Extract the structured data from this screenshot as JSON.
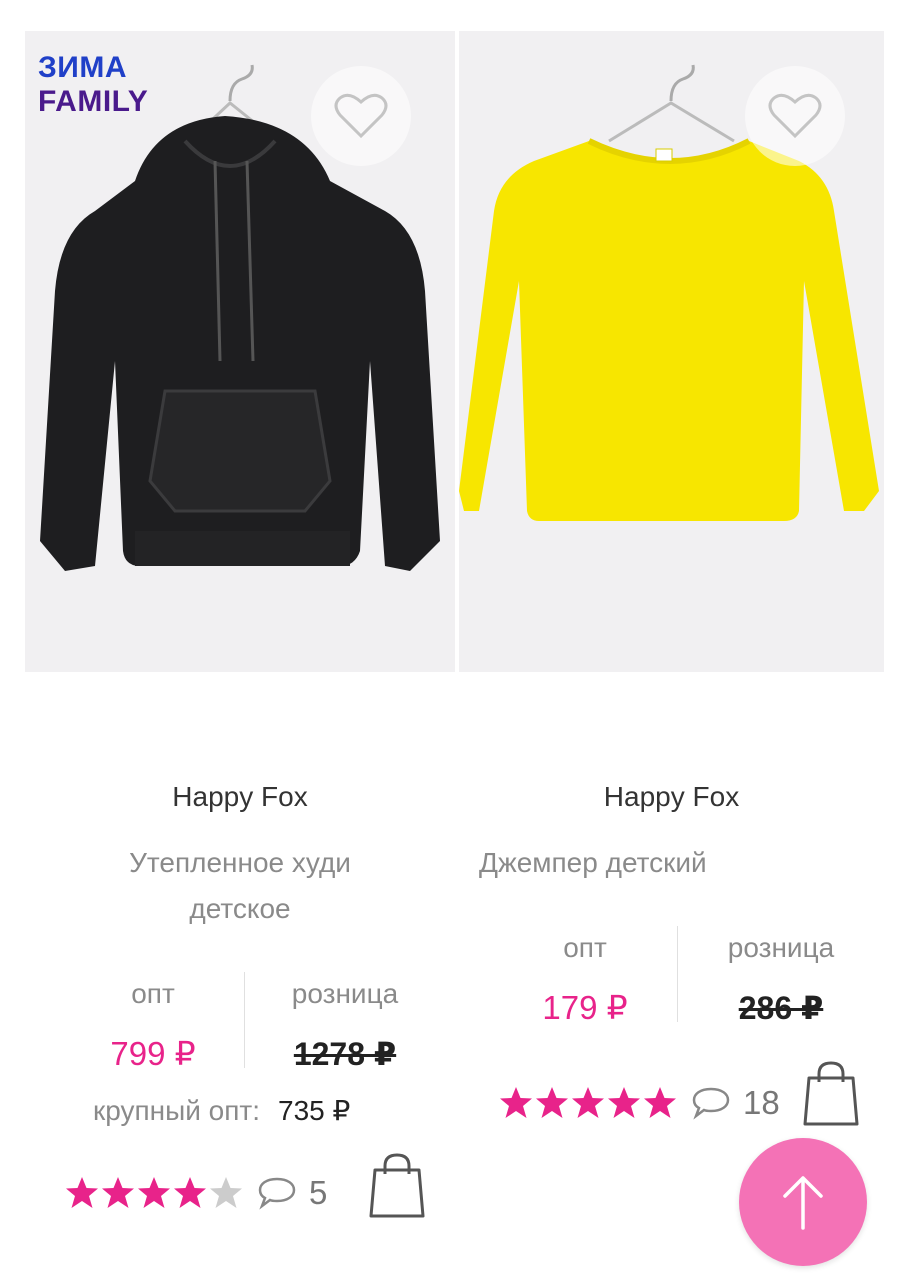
{
  "colors": {
    "accent": "#e8238a",
    "fab": "#f472b6",
    "star_empty": "#cccccc"
  },
  "products": [
    {
      "promo_line1": "ЗИМА",
      "promo_line2": "FAMILY",
      "brand": "Happy Fox",
      "title": "Утепленное худи детское",
      "opt_label": "опт",
      "opt_price": "799 ₽",
      "retail_label": "розница",
      "retail_price": "1278 ₽",
      "bulk_label": "крупный опт:",
      "bulk_price": "735 ₽",
      "rating": 4,
      "comments": "5",
      "garment_color": "#1e1e20"
    },
    {
      "brand": "Happy Fox",
      "title": "Джемпер детский",
      "opt_label": "опт",
      "opt_price": "179 ₽",
      "retail_label": "розница",
      "retail_price": "286 ₽",
      "rating": 5,
      "comments": "18",
      "garment_color": "#f7e600"
    }
  ],
  "icons": {
    "favorite": "heart-icon",
    "cart": "shopping-bag-icon",
    "comments": "speech-bubble-icon",
    "scroll_top": "arrow-up-icon"
  }
}
